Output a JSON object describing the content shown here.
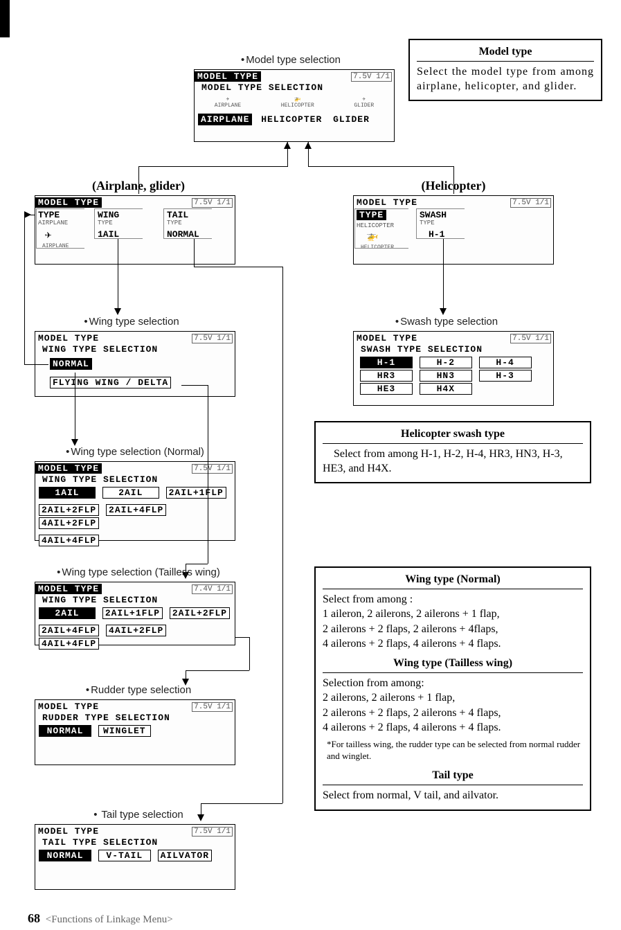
{
  "captions": {
    "modelTypeSel": "Model type selection",
    "airplaneGlider": "(Airplane, glider)",
    "helicopter": "(Helicopter)",
    "wingTypeSel": "Wing type selection",
    "swashTypeSel": "Swash type selection",
    "wingTypeSelNormal": "Wing type selection (Normal)",
    "wingTypeSelTailless": "Wing type selection (Tailless wing)",
    "rudderTypeSel": "Rudder type selection",
    "tailTypeSel": " Tail type selection"
  },
  "battery": {
    "val": "7.5V",
    "page": "1/1",
    "alt": "7.4V"
  },
  "lcd": {
    "modelSel": {
      "title": "MODEL TYPE",
      "sub": "MODEL TYPE SELECTION",
      "icons": {
        "a": "AIRPLANE",
        "h": "HELICOPTER",
        "g": "GLIDER"
      },
      "row": {
        "a": "AIRPLANE",
        "h": "HELICOPTER",
        "g": "GLIDER"
      }
    },
    "airglider": {
      "title": "MODEL TYPE",
      "type": {
        "hdr": "TYPE",
        "val": "AIRPLANE",
        "icon": "AIRPLANE"
      },
      "wing": {
        "hdr": "WING",
        "sub": "TYPE",
        "val": "1AIL"
      },
      "tail": {
        "hdr": "TAIL",
        "sub": "TYPE",
        "val": "NORMAL"
      }
    },
    "heli": {
      "title": "MODEL TYPE",
      "type": {
        "hdr": "TYPE",
        "val": "HELICOPTER",
        "icon": "HELICOPTER"
      },
      "swash": {
        "hdr": "SWASH",
        "sub": "TYPE",
        "val": "H-1"
      }
    },
    "wingSel": {
      "title": "MODEL TYPE",
      "sub": "WING TYPE SELECTION",
      "opt1": "NORMAL",
      "opt2": "FLYING WING / DELTA"
    },
    "swashSel": {
      "title": "MODEL TYPE",
      "sub": "SWASH TYPE SELECTION",
      "r1": {
        "a": "H-1",
        "b": "H-2",
        "c": "H-4"
      },
      "r2": {
        "a": "HR3",
        "b": "HN3",
        "c": "H-3"
      },
      "r3": {
        "a": "HE3",
        "b": "H4X"
      }
    },
    "wingNormal": {
      "title": "MODEL TYPE",
      "sub": "WING TYPE SELECTION",
      "r1": {
        "a": "1AIL",
        "b": "2AIL",
        "c": "2AIL+1FLP"
      },
      "r2": {
        "a": "2AIL+2FLP",
        "b": "2AIL+4FLP",
        "c": "4AIL+2FLP"
      },
      "r3": {
        "a": "4AIL+4FLP"
      }
    },
    "wingTailless": {
      "title": "MODEL TYPE",
      "sub": "WING TYPE SELECTION",
      "r1": {
        "a": "2AIL",
        "b": "2AIL+1FLP",
        "c": "2AIL+2FLP"
      },
      "r2": {
        "a": "2AIL+4FLP",
        "b": "4AIL+2FLP",
        "c": "4AIL+4FLP"
      }
    },
    "rudderSel": {
      "title": "MODEL TYPE",
      "sub": "RUDDER TYPE SELECTION",
      "a": "NORMAL",
      "b": "WINGLET"
    },
    "tailSel": {
      "title": "MODEL TYPE",
      "sub": "TAIL TYPE SELECTION",
      "a": "NORMAL",
      "b": "V-TAIL",
      "c": "AILVATOR"
    }
  },
  "desc": {
    "modelType": {
      "title": "Model type",
      "body": "Select the model type from among airplane, helicopter, and glider."
    },
    "heliSwash": {
      "title": "Helicopter swash type",
      "body": "Select from among H-1, H-2, H-4, HR3, HN3, H-3, HE3, and H4X."
    },
    "wingNormalTitle": "Wing type (Normal)",
    "wingNormal": {
      "l1": "Select from among :",
      "l2": "1 aileron, 2 ailerons, 2 ailerons + 1 flap,",
      "l3": "2 ailerons + 2 flaps,  2 ailerons + 4flaps,",
      "l4": "4 ailerons + 2 flaps,  4 ailerons + 4 flaps."
    },
    "wingTaillessTitle": "Wing type (Tailless wing)",
    "wingTailless": {
      "l1": "Selection from among:",
      "l2": "2 ailerons, 2 ailerons + 1 flap,",
      "l3": "2 ailerons + 2 flaps, 2 ailerons + 4 flaps,",
      "l4": "4 ailerons + 2 flaps,  4 ailerons + 4 flaps.",
      "note": "*For tailless wing, the rudder type can be selected from normal rudder and winglet."
    },
    "tailTypeTitle": "Tail type",
    "tailType": "Select from  normal, V tail, and ailvator."
  },
  "footer": {
    "page": "68",
    "title": "<Functions of Linkage Menu>"
  }
}
